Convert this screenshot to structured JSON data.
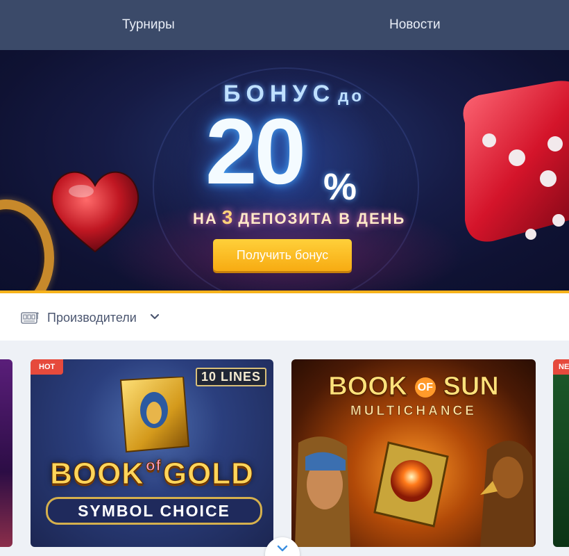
{
  "nav": {
    "items": [
      {
        "label": "Турниры"
      },
      {
        "label": "Новости"
      }
    ]
  },
  "banner": {
    "headline": "БОНУС",
    "headline_small": "до",
    "percent_number": "20",
    "percent_sign": "%",
    "sub_before": "НА",
    "sub_number": "3",
    "sub_after": "ДЕПОЗИТА В ДЕНЬ",
    "button_label": "Получить бонус",
    "accent_color": "#f6b21b"
  },
  "providers": {
    "label": "Производители",
    "icon": "slot-machine-icon"
  },
  "games": [
    {
      "badge": "HOT",
      "title_part1": "BOOK",
      "title_of": "of",
      "title_part2": "GOLD",
      "subtitle": "SYMBOL CHOICE",
      "tag": "10 LINES"
    },
    {
      "title_part1": "BOOK",
      "title_of": "OF",
      "title_part2": "SUN",
      "subtitle": "MULTICHANCE"
    },
    {
      "badge": "NE"
    }
  ]
}
